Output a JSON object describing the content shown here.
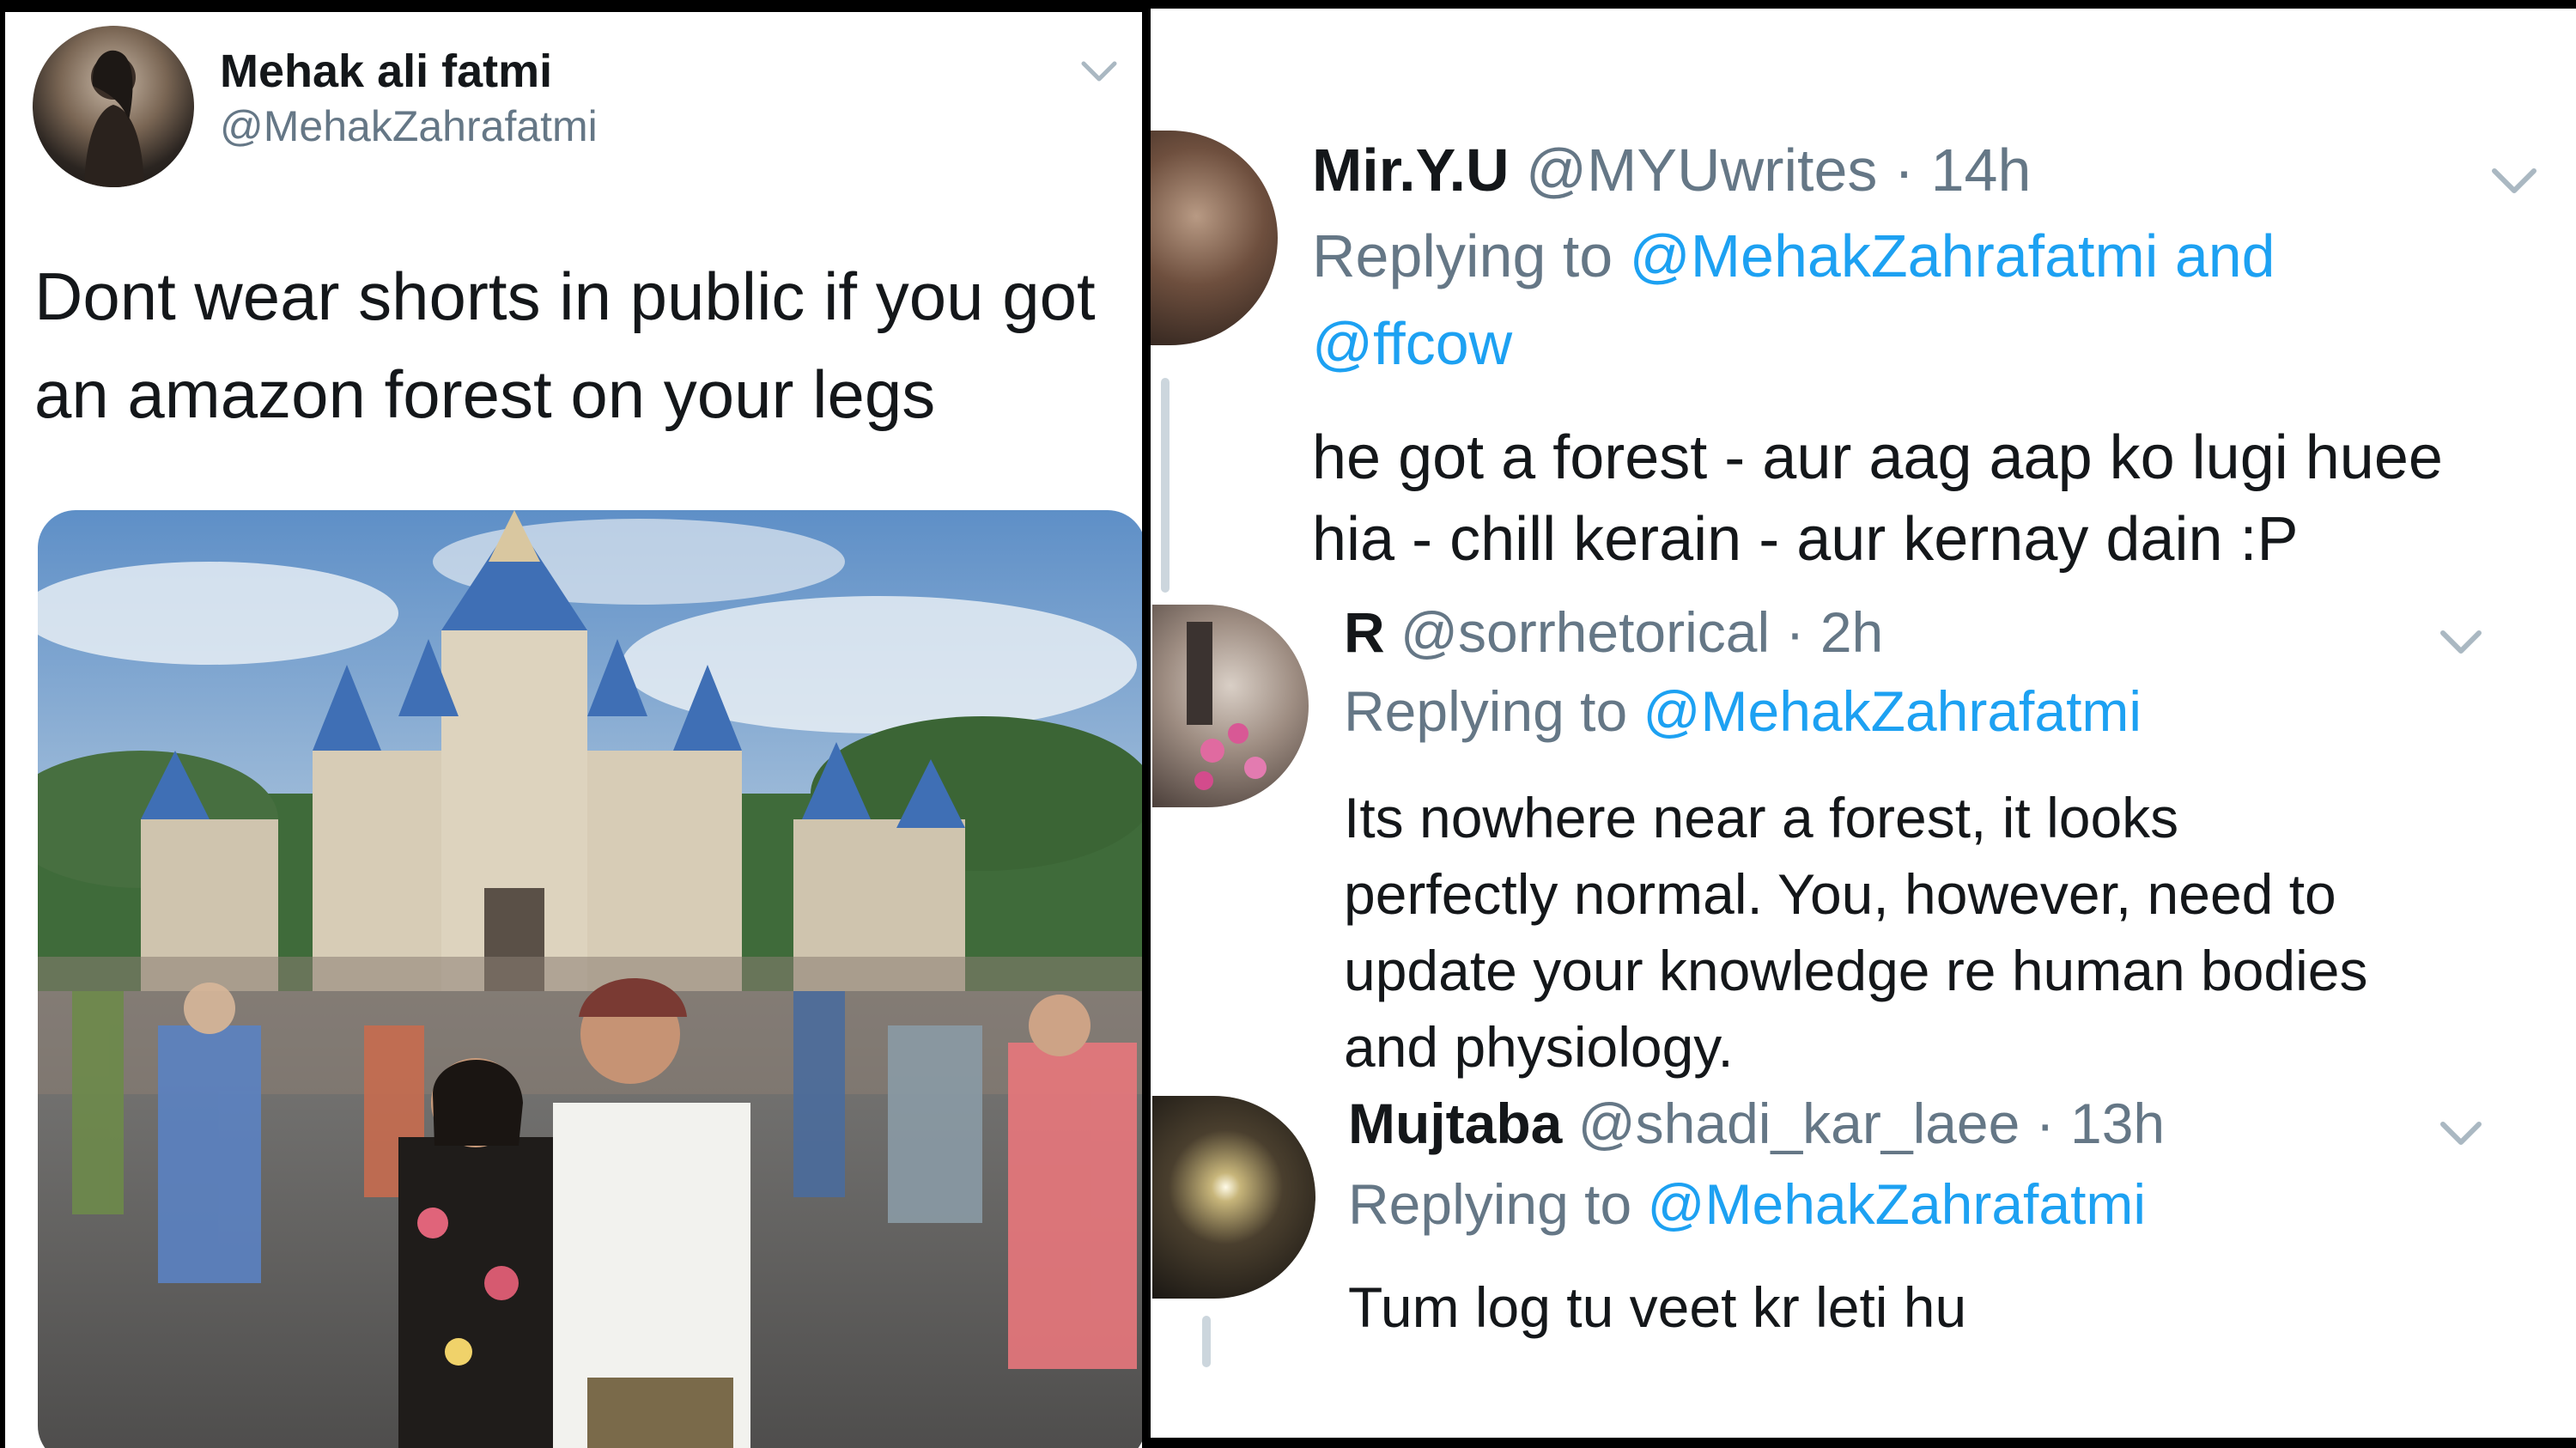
{
  "original_tweet": {
    "author_name": "Mehak ali fatmi",
    "author_handle": "@MehakZahrafatmi",
    "text_line1": "Dont wear shorts in public if you got",
    "text_line2": "an amazon forest on your legs",
    "avatar_icon": "profile-photo",
    "menu_icon": "chevron-down-icon"
  },
  "replies": [
    {
      "author_name": "Mir.Y.U",
      "author_handle": "@MYUwrites",
      "time": "· 14h",
      "replying_prefix": "Replying to ",
      "replying_mentions_line1": "@MehakZahrafatmi and",
      "replying_mentions_line2": "@ffcow",
      "text_line1": "he got a forest - aur aag aap ko lugi huee",
      "text_line2": "hia - chill kerain - aur kernay dain :P"
    },
    {
      "author_name": "R",
      "author_handle": "@sorrhetorical",
      "time": "· 2h",
      "replying_prefix": "Replying to ",
      "replying_mentions_line1": "@MehakZahrafatmi",
      "text_line1": "Its nowhere near a forest, it looks",
      "text_line2": "perfectly normal. You, however, need to",
      "text_line3": "update your knowledge re human bodies",
      "text_line4": "and physiology."
    },
    {
      "author_name": "Mujtaba",
      "author_handle": "@shadi_kar_laee",
      "time": "· 13h",
      "replying_prefix": "Replying to ",
      "replying_mentions_line1": "@MehakZahrafatmi",
      "text_line1": "Tum log tu veet kr leti hu"
    }
  ],
  "colors": {
    "text": "#14171a",
    "secondary": "#657786",
    "link": "#1da1f2",
    "thread_line": "#ccd6dd"
  }
}
